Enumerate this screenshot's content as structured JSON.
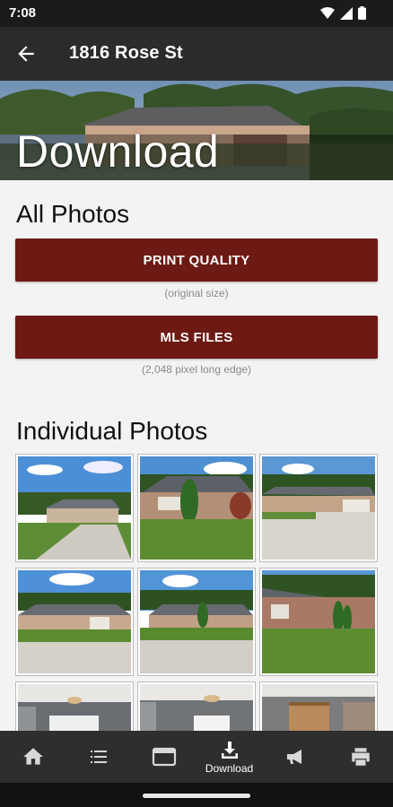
{
  "status_bar": {
    "time": "7:08"
  },
  "app_bar": {
    "title": "1816 Rose St"
  },
  "hero": {
    "title": "Download"
  },
  "all_photos": {
    "heading": "All Photos",
    "print_quality_label": "PRINT QUALITY",
    "print_quality_note": "(original size)",
    "mls_files_label": "MLS FILES",
    "mls_files_note": "(2,048 pixel long edge)"
  },
  "individual_photos": {
    "heading": "Individual Photos",
    "photo_count_visible": 9
  },
  "bottom_nav": {
    "items": [
      {
        "icon": "home-icon",
        "label": ""
      },
      {
        "icon": "list-icon",
        "label": ""
      },
      {
        "icon": "browser-icon",
        "label": ""
      },
      {
        "icon": "download-icon",
        "label": "Download",
        "active": true
      },
      {
        "icon": "megaphone-icon",
        "label": ""
      },
      {
        "icon": "print-icon",
        "label": ""
      }
    ]
  },
  "colors": {
    "accent": "#6d1a14",
    "app_bar": "#2b2b2b",
    "nav": "#2e2e2e",
    "background": "#f3f3f3"
  }
}
